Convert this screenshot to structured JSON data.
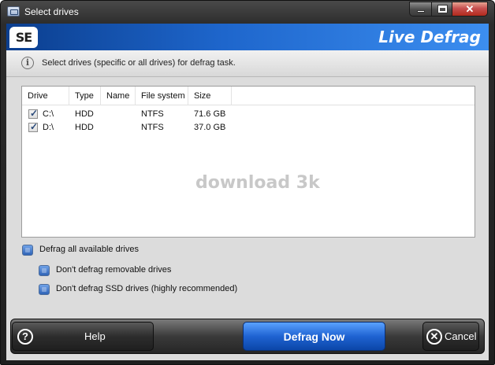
{
  "window": {
    "title": "Select drives",
    "close_glyph": "✕"
  },
  "brand": {
    "logo_text": "SE",
    "name": "Live Defrag",
    "colors": {
      "bar_start": "#0b3e8e",
      "bar_end": "#3c8ef0"
    }
  },
  "info": {
    "icon": "info-icon",
    "icon_glyph": "i",
    "text": "Select drives (specific or all drives) for defrag task."
  },
  "drive_list": {
    "columns": [
      "Drive",
      "Type",
      "Name",
      "File system",
      "Size"
    ],
    "rows": [
      {
        "checked": true,
        "drive": "C:\\",
        "type": "HDD",
        "name": "",
        "file_system": "NTFS",
        "size": "71.6 GB"
      },
      {
        "checked": true,
        "drive": "D:\\",
        "type": "HDD",
        "name": "",
        "file_system": "NTFS",
        "size": "37.0 GB"
      }
    ],
    "watermark": "download 3k"
  },
  "options": {
    "all_drives": "Defrag all available drives",
    "no_removable": "Don't defrag removable drives",
    "no_ssd": "Don't defrag SSD drives (highly recommended)"
  },
  "buttons": {
    "help": {
      "label": "Help",
      "icon": "question-icon",
      "glyph": "?"
    },
    "defrag_now": {
      "label": "Defrag Now"
    },
    "cancel": {
      "label": "Cancel",
      "icon": "close-circle-icon",
      "glyph": "✕"
    }
  }
}
